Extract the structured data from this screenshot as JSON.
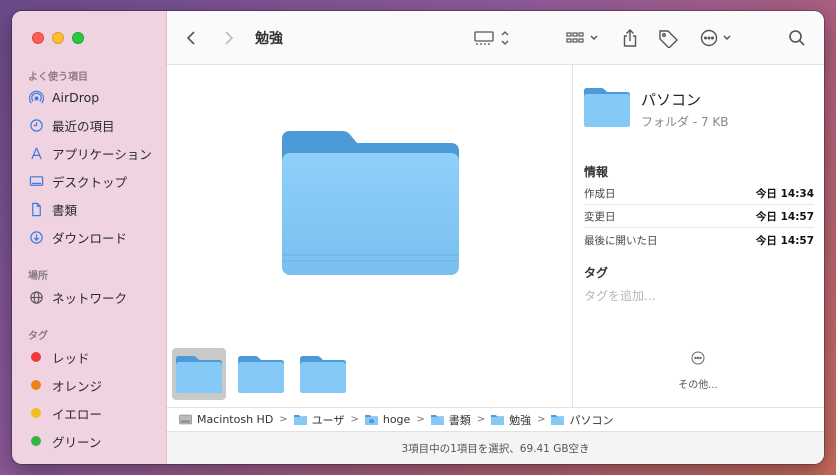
{
  "window": {
    "title": "勉強"
  },
  "sidebar": {
    "favorites_header": "よく使う項目",
    "favorites": [
      {
        "label": "AirDrop",
        "icon": "airdrop-icon"
      },
      {
        "label": "最近の項目",
        "icon": "clock-icon"
      },
      {
        "label": "アプリケーション",
        "icon": "applications-icon"
      },
      {
        "label": "デスクトップ",
        "icon": "desktop-icon"
      },
      {
        "label": "書類",
        "icon": "document-icon"
      },
      {
        "label": "ダウンロード",
        "icon": "download-icon"
      }
    ],
    "locations_header": "場所",
    "locations": [
      {
        "label": "ネットワーク",
        "icon": "network-icon"
      }
    ],
    "tags_header": "タグ",
    "tags": [
      {
        "label": "レッド",
        "color": "#f03a3a"
      },
      {
        "label": "オレンジ",
        "color": "#f0821e"
      },
      {
        "label": "イエロー",
        "color": "#f0c020"
      },
      {
        "label": "グリーン",
        "color": "#34b540"
      }
    ]
  },
  "inspector": {
    "name": "パソコン",
    "kind_size": "フォルダ - 7 KB",
    "info_header": "情報",
    "rows": [
      {
        "key": "作成日",
        "value": "今日 14:34"
      },
      {
        "key": "変更日",
        "value": "今日 14:57"
      },
      {
        "key": "最後に開いた日",
        "value": "今日 14:57"
      }
    ],
    "tags_header": "タグ",
    "tags_placeholder": "タグを追加...",
    "more_label": "その他..."
  },
  "pathbar": [
    {
      "label": "Macintosh HD",
      "icon": "hard-drive-icon"
    },
    {
      "label": "ユーザ",
      "icon": "folder-icon"
    },
    {
      "label": "hoge",
      "icon": "home-folder-icon"
    },
    {
      "label": "書類",
      "icon": "folder-icon"
    },
    {
      "label": "勉強",
      "icon": "folder-icon"
    },
    {
      "label": "パソコン",
      "icon": "folder-icon"
    }
  ],
  "status": "3項目中の1項目を選択、69.41 GB空き",
  "colors": {
    "accent": "#3a7be0",
    "sidebar_bg": "#efd3e1",
    "folder_blue": "#7cc4f4"
  }
}
